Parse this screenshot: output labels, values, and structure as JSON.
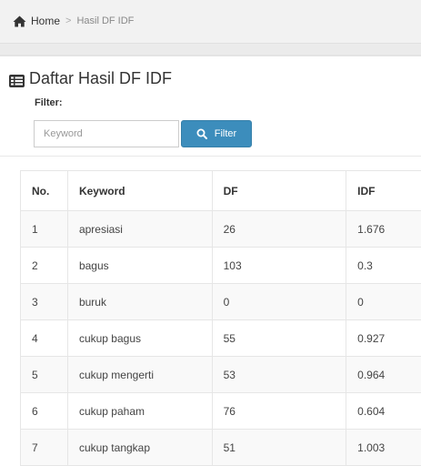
{
  "breadcrumb": {
    "home": "Home",
    "current": "Hasil DF IDF"
  },
  "page": {
    "title": "Daftar Hasil DF IDF",
    "filter_label": "Filter:",
    "keyword_placeholder": "Keyword",
    "filter_button": "Filter"
  },
  "colors": {
    "primary": "#3c8dbc",
    "breadcrumb_bg": "#f2f2f2"
  },
  "table": {
    "headers": [
      "No.",
      "Keyword",
      "DF",
      "IDF"
    ],
    "rows": [
      [
        "1",
        "apresiasi",
        "26",
        "1.676"
      ],
      [
        "2",
        "bagus",
        "103",
        "0.3"
      ],
      [
        "3",
        "buruk",
        "0",
        "0"
      ],
      [
        "4",
        "cukup bagus",
        "55",
        "0.927"
      ],
      [
        "5",
        "cukup mengerti",
        "53",
        "0.964"
      ],
      [
        "6",
        "cukup paham",
        "76",
        "0.604"
      ],
      [
        "7",
        "cukup tangkap",
        "51",
        "1.003"
      ]
    ]
  }
}
